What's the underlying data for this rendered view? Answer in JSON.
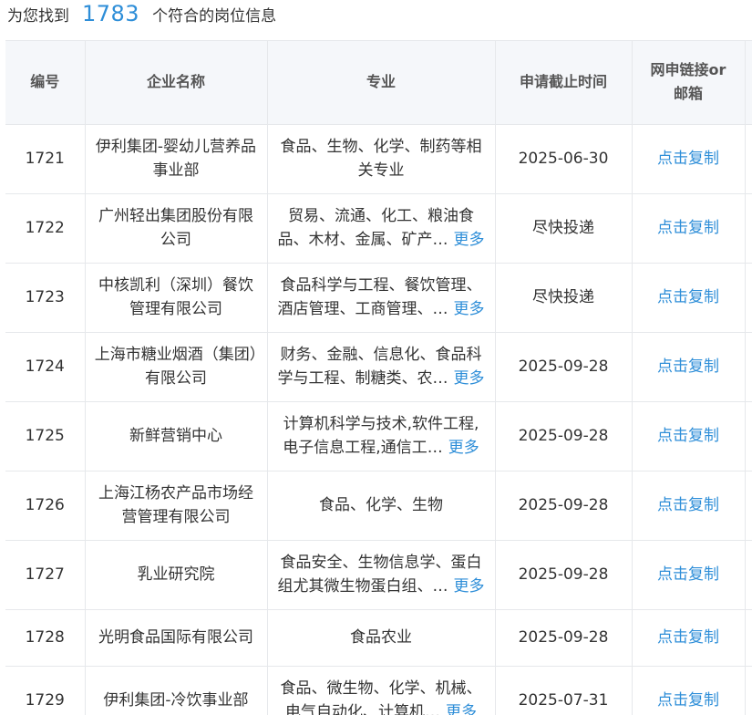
{
  "summary": {
    "prefix": "为您找到",
    "count": "1783",
    "suffix": "个符合的岗位信息"
  },
  "headers": {
    "id": "编号",
    "company": "企业名称",
    "major": "专业",
    "deadline": "申请截止时间",
    "apply_line1": "网申链接or",
    "apply_line2": "邮箱"
  },
  "accent_color": "#2e8ed8",
  "rows": [
    {
      "id": "1721",
      "company": "伊利集团-婴幼儿营养品事业部",
      "major_l1": "食品、生物、化学、制药等相",
      "major_l2": "关专业",
      "more": "",
      "deadline": "2025-06-30",
      "action": "点击复制"
    },
    {
      "id": "1722",
      "company": "广州轻出集团股份有限公司",
      "major_l1": "贸易、流通、化工、粮油食",
      "major_l2": "品、木材、金属、矿产…",
      "more": "更多",
      "deadline": "尽快投递",
      "action": "点击复制"
    },
    {
      "id": "1723",
      "company": "中核凯利（深圳）餐饮管理有限公司",
      "major_l1": "食品科学与工程、餐饮管理、",
      "major_l2": "酒店管理、工商管理、…",
      "more": "更多",
      "deadline": "尽快投递",
      "action": "点击复制"
    },
    {
      "id": "1724",
      "company": "上海市糖业烟酒（集团）有限公司",
      "major_l1": "财务、金融、信息化、食品科",
      "major_l2": "学与工程、制糖类、农…",
      "more": "更多",
      "deadline": "2025-09-28",
      "action": "点击复制"
    },
    {
      "id": "1725",
      "company": "新鲜营销中心",
      "major_l1": "计算机科学与技术,软件工程,",
      "major_l2": "电子信息工程,通信工…",
      "more": "更多",
      "deadline": "2025-09-28",
      "action": "点击复制"
    },
    {
      "id": "1726",
      "company": "上海江杨农产品市场经营管理有限公司",
      "major_l1": "食品、化学、生物",
      "major_l2": "",
      "more": "",
      "deadline": "2025-09-28",
      "action": "点击复制"
    },
    {
      "id": "1727",
      "company": "乳业研究院",
      "major_l1": "食品安全、生物信息学、蛋白",
      "major_l2": "组尤其微生物蛋白组、…",
      "more": "更多",
      "deadline": "2025-09-28",
      "action": "点击复制"
    },
    {
      "id": "1728",
      "company": "光明食品国际有限公司",
      "major_l1": "食品农业",
      "major_l2": "",
      "more": "",
      "deadline": "2025-09-28",
      "action": "点击复制"
    },
    {
      "id": "1729",
      "company": "伊利集团-冷饮事业部",
      "major_l1": "食品、微生物、化学、机械、",
      "major_l2": "电气自动化、计算机…",
      "more": "更多",
      "deadline": "2025-07-31",
      "action": "点击复制"
    }
  ]
}
